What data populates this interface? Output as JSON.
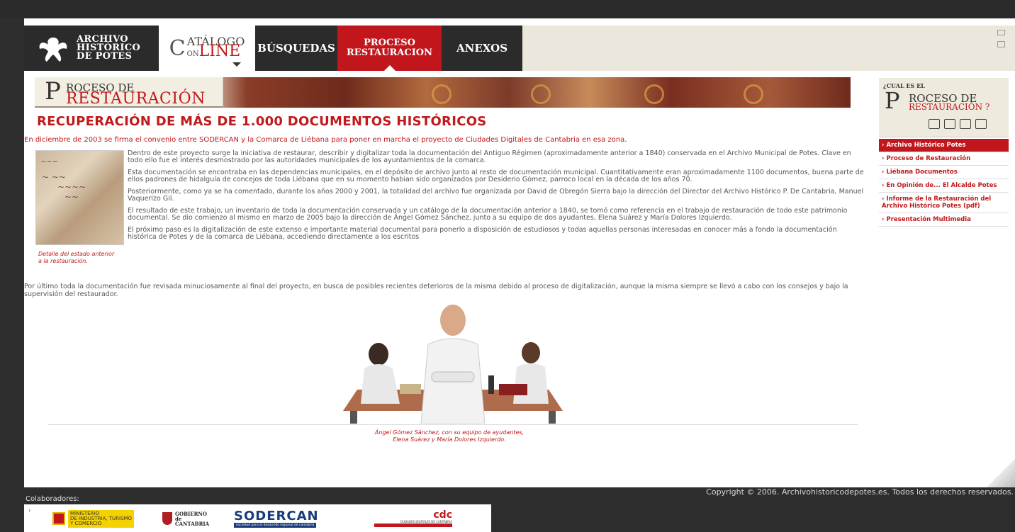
{
  "nav": {
    "logo_text": [
      "ARCHIVO",
      "HISTÓRICO",
      "DE POTES"
    ],
    "catalog": {
      "big": "C",
      "line1": "ATÁLOGO",
      "line2_prefix": "ON",
      "line2_main": "LINE"
    },
    "busquedas": "BÚSQUEDAS",
    "proceso": [
      "PROCESO",
      "RESTAURACION"
    ],
    "anexos": "ANEXOS"
  },
  "banner": {
    "initial": "P",
    "line1": "ROCESO DE",
    "line2": "RESTAURACIÓN"
  },
  "main": {
    "title": "RECUPERACIÓN DE MÁS DE 1.000 DOCUMENTOS HISTÓRICOS",
    "intro": "En diciembre de 2003 se firma el convenio entre SODERCAN y la Comarca de Liébana para poner en marcha el proyecto de Ciudades Digitales de Cantabria en esa zona.",
    "photo_caption": "Detalle del estado anterior a la restauración.",
    "paragraphs": [
      "Dentro de este proyecto surge la iniciativa de restaurar, describir y digitalizar toda la documentación del Antiguo Régimen (aproximadamente anterior a 1840) conservada en el Archivo Municipal de Potes. Clave en todo ello fue el interés desmostrado por las autoridades municipales de los ayuntamientos de la comarca.",
      "Esta documentación se encontraba en las dependencias municipales, en el depósito de archivo junto al resto de documentación municipal. Cuantitativamente eran aproximadamente 1100 documentos, buena parte de ellos padrones de hidalguía de concejos de toda Liébana que en su momento habian sido organizados por Desiderio Gómez, parroco local en la década de los años 70.",
      "Posteriormente, como ya se ha comentado, durante los años 2000 y 2001, la totalidad del archivo fue organizada por David de Obregón Sierra bajo la dirección del Director del Archivo Histórico P. De Cantabria, Manuel Vaquerizo Gil.",
      "El resultado de este trabajo, un inventario de toda la documentación conservada y un catálogo de la documentación anterior a 1840, se tomó como referencia en el trabajo de restauración de todo este patrimonio documental. Se dio comienzo al mismo en marzo de 2005 bajo la dirección de Ángel Gómez Sánchez, junto a su equipo de dos ayudantes, Elena Suárez y María Dolores Izquierdo.",
      "El próximo paso es la digitalización de este extenso e importante material documental para ponerlo a disposición de estudiosos y todas aquellas personas interesadas en conocer más a fondo la documentación histórica de Potes y de la comarca de Liébana, accediendo directamente a los escritos"
    ],
    "final": "Por último toda la documentación fue revisada minuciosamente al final del proyecto, en busca de posibles recientes deterioros de la misma debido al proceso de digitalización, aunque la misma siempre se llevó a cabo con los consejos y bajo la supervisión del restaurador.",
    "team_caption": [
      "Ángel Gómez Sánchez, con su equipo de ayudantes,",
      "Elena Suárez y María Dolores Izquierdo."
    ]
  },
  "sidebar": {
    "question": "¿CUAL ES EL",
    "initial": "P",
    "line1": "ROCESO DE",
    "line2": "RESTAURACIÓN ?",
    "items": [
      "Archivo Histórico Potes",
      "Proceso de Restauración",
      "Liébana Documentos",
      "En Opinión de... El Alcalde Potes",
      "Informe de la Restauración del Archivo Histórico Potes (pdf)",
      "Presentación Multimedia"
    ]
  },
  "footer": {
    "copyright": "Copyright © 2006. Archivohistoricodepotes.es. Todos los derechos reservados.",
    "colaboradores": "Colaboradores:",
    "logos": {
      "ministerio": [
        "MINISTERIO",
        "DE INDUSTRIA, TURISMO",
        "Y COMERCIO"
      ],
      "gobierno": [
        "GOBIERNO",
        "de",
        "CANTABRIA"
      ],
      "sodercan": "SODERCAN",
      "sodercan_sub": "sociedad para el desarrollo regional de cantabria",
      "cdc": "cdc",
      "cdc_sub": "CIUDADES DIGITALES DE CANTABRIA"
    }
  }
}
